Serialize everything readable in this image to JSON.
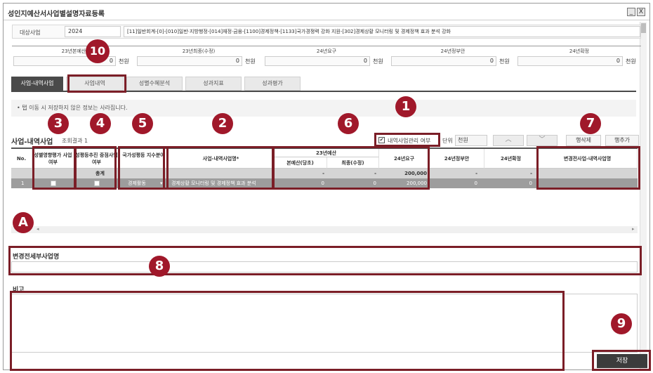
{
  "window": {
    "title": "성인지예산서사업별설명자료등록",
    "min_label": "_",
    "close_label": "X"
  },
  "project": {
    "label": "대상사업",
    "year": "2024",
    "path": "[11]일반회계-[0]-[010]일반·지방행정-[014]재정·금융-[1100]경제정책-[1133]국가경쟁력 강화 지원-[302]경제상황 모니터링 및 경제정책 효과 분석 강화"
  },
  "budget": {
    "unit": "천원",
    "columns": [
      {
        "label": "23년본예산",
        "value": "0"
      },
      {
        "label": "23년최종(수정)",
        "value": "0"
      },
      {
        "label": "24년요구",
        "value": "0"
      },
      {
        "label": "24년정부안",
        "value": "0"
      },
      {
        "label": "24년확정",
        "value": "0"
      }
    ]
  },
  "tabs": [
    "사업-내역사업",
    "사업내역",
    "성별수혜분석",
    "성과지표",
    "성과평가"
  ],
  "notice": "• 탭 이동 시 저장하지 않은 정보는 사라집니다.",
  "section": {
    "title": "사업-내역사업",
    "result_label": "조회결과",
    "result_count": "1",
    "checkbox_label": "내역사업관리 여부",
    "unit_label": "단위",
    "unit_value": "천원",
    "up": "︿",
    "down": "﹀",
    "delete_row": "행삭제",
    "add_row": "행추가"
  },
  "grid": {
    "headers": {
      "no": "No.",
      "impact": "성별영향평가 사업여부",
      "focus": "성평등추진 중점사업여부",
      "field": "국가성평등 지수분야",
      "name": "사업-내역사업명*",
      "y23": "23년예산",
      "y23_main": "본예산(당초)",
      "y23_final": "최종(수정)",
      "y24_req": "24년요구",
      "y24_gov": "24년정부안",
      "y24_conf": "24년확정",
      "changed": "변경전사업-내역사업명"
    },
    "sum_row": {
      "label": "총계",
      "main": "-",
      "final": "-",
      "req": "200,000",
      "gov": "-",
      "conf": "-"
    },
    "rows": [
      {
        "no": "1",
        "field": "경제활동",
        "name": "경제상황 모니터링 및 경제정책 효과 분석",
        "main": "0",
        "final": "0",
        "req": "200,000",
        "gov": "0",
        "conf": "0"
      }
    ]
  },
  "labels": {
    "changed_detail": "변경전세부사업명",
    "remarks": "비고",
    "save": "저장"
  },
  "annotations": [
    "1",
    "2",
    "3",
    "4",
    "5",
    "6",
    "7",
    "8",
    "9",
    "10",
    "A"
  ],
  "colors": {
    "accent": "#a0182a",
    "dark": "#4a4a4a"
  }
}
